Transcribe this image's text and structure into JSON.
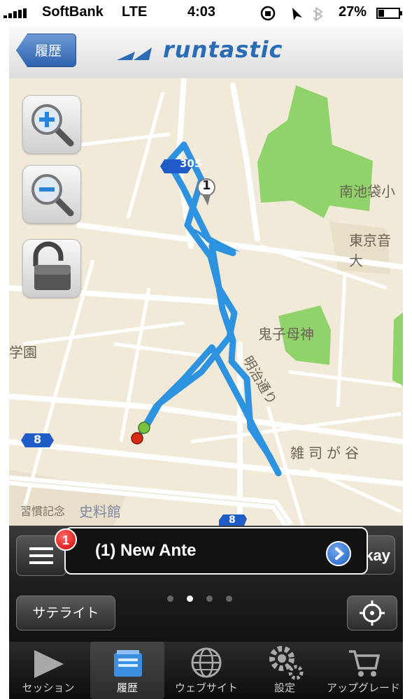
{
  "status_bar": {
    "carrier": "SoftBank",
    "network": "LTE",
    "time": "4:03",
    "battery": "27%"
  },
  "header": {
    "back_label": "履歴",
    "logo_text": "runtastic"
  },
  "map": {
    "labels": {
      "minami_ikebukuro": "南池袋小",
      "tokyo_ongaku": "東京音大",
      "kishimojin": "鬼子母神",
      "gakuen": "学園",
      "meiji_dori": "明治通り",
      "zoshigaya": "雑司が谷",
      "shiryokan": "史料館",
      "overlap_text": "習慣記念",
      "route_305": "305",
      "route_8a": "8",
      "route_8b": "8"
    },
    "marker_label": "1"
  },
  "toolbar": {
    "notification_badge": "1",
    "notification_text": "(1) New Ante",
    "tab_badge": "1",
    "okay_text": "kay",
    "satellite_label": "サテライト"
  },
  "tabbar": {
    "tabs": [
      {
        "label": "セッション"
      },
      {
        "label": "履歴"
      },
      {
        "label": "ウェブサイト"
      },
      {
        "label": "設定"
      },
      {
        "label": "アップグレード"
      }
    ]
  },
  "colors": {
    "route": "#2d93e0",
    "park": "#8fd36a",
    "map_bg": "#f2ead8",
    "accent": "#2a6bb5"
  }
}
